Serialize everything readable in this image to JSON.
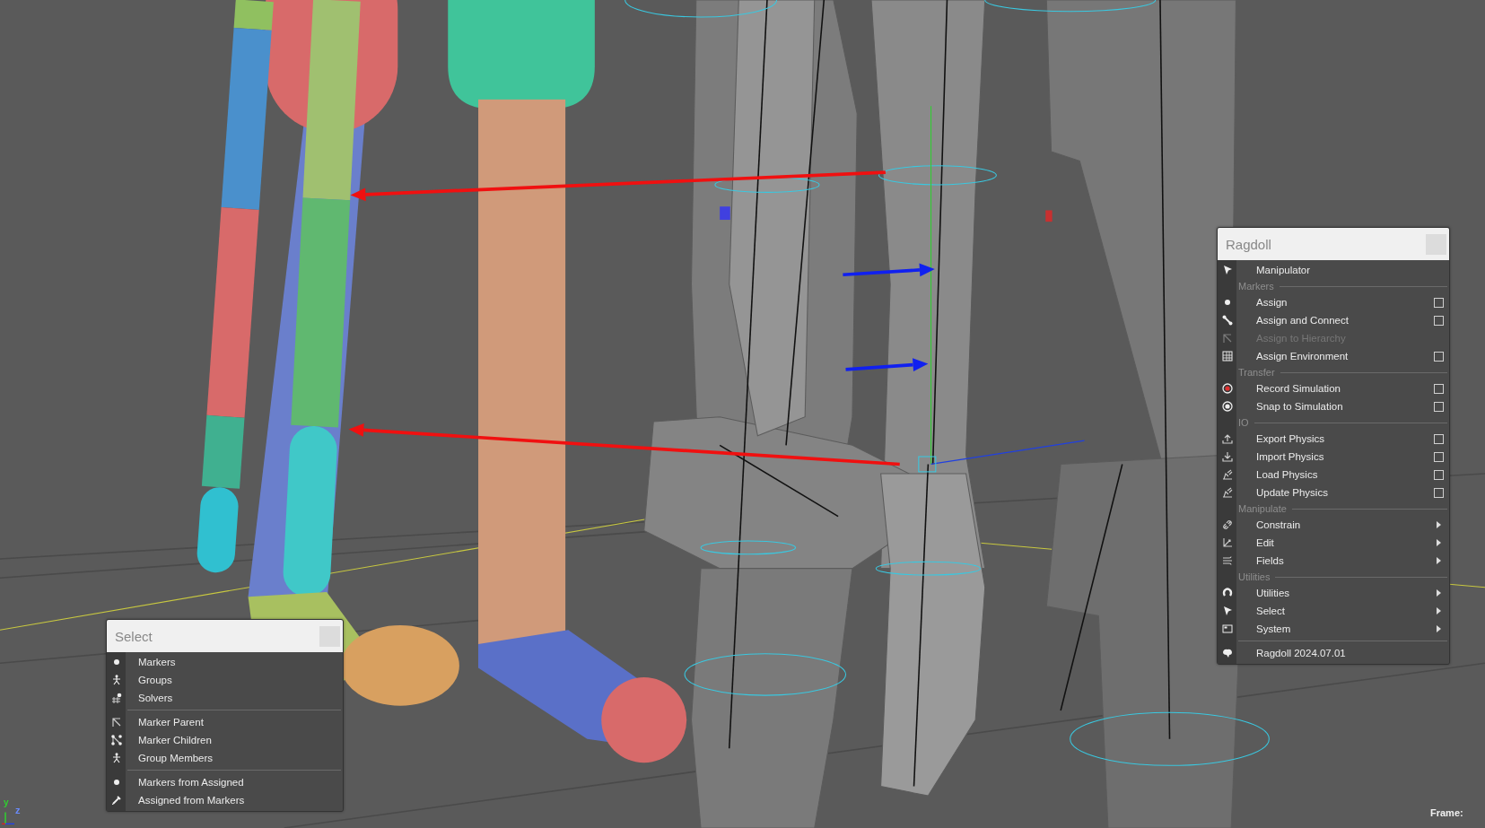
{
  "ragdoll_menu": {
    "title": "Ragdoll",
    "items": [
      {
        "kind": "item",
        "label": "Manipulator",
        "disabled": false,
        "option_box": false,
        "submenu": false
      },
      {
        "kind": "section",
        "label": "Markers"
      },
      {
        "kind": "item",
        "label": "Assign",
        "disabled": false,
        "option_box": true,
        "submenu": false
      },
      {
        "kind": "item",
        "label": "Assign and Connect",
        "disabled": false,
        "option_box": true,
        "submenu": false
      },
      {
        "kind": "item",
        "label": "Assign to Hierarchy",
        "disabled": true,
        "option_box": false,
        "submenu": false
      },
      {
        "kind": "item",
        "label": "Assign Environment",
        "disabled": false,
        "option_box": true,
        "submenu": false
      },
      {
        "kind": "section",
        "label": "Transfer"
      },
      {
        "kind": "item",
        "label": "Record Simulation",
        "disabled": false,
        "option_box": true,
        "submenu": false
      },
      {
        "kind": "item",
        "label": "Snap to Simulation",
        "disabled": false,
        "option_box": true,
        "submenu": false
      },
      {
        "kind": "section",
        "label": "IO"
      },
      {
        "kind": "item",
        "label": "Export Physics",
        "disabled": false,
        "option_box": true,
        "submenu": false
      },
      {
        "kind": "item",
        "label": "Import Physics",
        "disabled": false,
        "option_box": true,
        "submenu": false
      },
      {
        "kind": "item",
        "label": "Load Physics",
        "disabled": false,
        "option_box": true,
        "submenu": false
      },
      {
        "kind": "item",
        "label": "Update Physics",
        "disabled": false,
        "option_box": true,
        "submenu": false
      },
      {
        "kind": "section",
        "label": "Manipulate"
      },
      {
        "kind": "item",
        "label": "Constrain",
        "disabled": false,
        "option_box": false,
        "submenu": true
      },
      {
        "kind": "item",
        "label": "Edit",
        "disabled": false,
        "option_box": false,
        "submenu": true
      },
      {
        "kind": "item",
        "label": "Fields",
        "disabled": false,
        "option_box": false,
        "submenu": true
      },
      {
        "kind": "section",
        "label": "Utilities"
      },
      {
        "kind": "item",
        "label": "Utilities",
        "disabled": false,
        "option_box": false,
        "submenu": true
      },
      {
        "kind": "item",
        "label": "Select",
        "disabled": false,
        "option_box": false,
        "submenu": true
      },
      {
        "kind": "item",
        "label": "System",
        "disabled": false,
        "option_box": false,
        "submenu": true
      },
      {
        "kind": "divider"
      },
      {
        "kind": "item",
        "label": "Ragdoll 2024.07.01",
        "disabled": false,
        "option_box": false,
        "submenu": false
      }
    ]
  },
  "select_menu": {
    "title": "Select",
    "items": [
      {
        "kind": "item",
        "label": "Markers",
        "disabled": false,
        "option_box": false,
        "submenu": false
      },
      {
        "kind": "item",
        "label": "Groups",
        "disabled": false,
        "option_box": false,
        "submenu": false
      },
      {
        "kind": "item",
        "label": "Solvers",
        "disabled": false,
        "option_box": false,
        "submenu": false
      },
      {
        "kind": "divider"
      },
      {
        "kind": "item",
        "label": "Marker Parent",
        "disabled": false,
        "option_box": false,
        "submenu": false
      },
      {
        "kind": "item",
        "label": "Marker Children",
        "disabled": false,
        "option_box": false,
        "submenu": false
      },
      {
        "kind": "item",
        "label": "Group Members",
        "disabled": false,
        "option_box": false,
        "submenu": false
      },
      {
        "kind": "divider"
      },
      {
        "kind": "item",
        "label": "Markers from Assigned",
        "disabled": false,
        "option_box": false,
        "submenu": false
      },
      {
        "kind": "item",
        "label": "Assigned from Markers",
        "disabled": false,
        "option_box": false,
        "submenu": false
      }
    ]
  },
  "axis_labels": [
    "y",
    "z"
  ],
  "frame_label": "Frame:"
}
